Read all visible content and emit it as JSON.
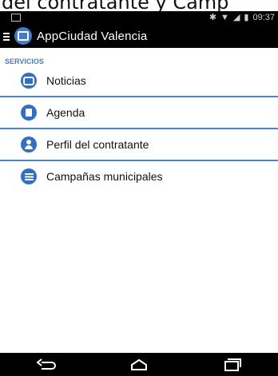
{
  "caption": {
    "text": "del contratante y Camp"
  },
  "statusbar": {
    "time": "09:37",
    "icons": [
      "bluetooth-icon",
      "wifi-icon",
      "signal-icon",
      "battery-icon"
    ]
  },
  "appbar": {
    "title": "AppCiudad Valencia"
  },
  "section": {
    "title": "SERVICIOS"
  },
  "items": [
    {
      "label": "Noticias",
      "icon": "chat-bubble-icon"
    },
    {
      "label": "Agenda",
      "icon": "agenda-book-icon"
    },
    {
      "label": "Perfil del contratante",
      "icon": "person-icon"
    },
    {
      "label": "Campañas municipales",
      "icon": "list-icon"
    }
  ],
  "colors": {
    "accent": "#2f6fca",
    "divider": "#4a86d8",
    "bar": "#000000"
  }
}
